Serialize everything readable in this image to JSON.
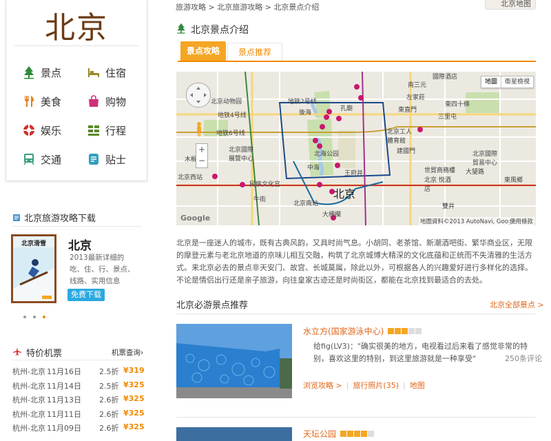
{
  "sidebar": {
    "city": "北京",
    "categories": [
      {
        "label": "景点",
        "icon": "tree-icon",
        "color": "#2e8b3a"
      },
      {
        "label": "住宿",
        "icon": "bed-icon",
        "color": "#9a8a2a"
      },
      {
        "label": "美食",
        "icon": "fork-knife-icon",
        "color": "#e08020"
      },
      {
        "label": "购物",
        "icon": "shopping-bag-icon",
        "color": "#d0307a"
      },
      {
        "label": "娱乐",
        "icon": "lifebuoy-icon",
        "color": "#d03030"
      },
      {
        "label": "行程",
        "icon": "grid-icon",
        "color": "#5a8a2a"
      },
      {
        "label": "交通",
        "icon": "train-icon",
        "color": "#3aa07a"
      },
      {
        "label": "贴士",
        "icon": "note-icon",
        "color": "#30a0c0"
      }
    ]
  },
  "download": {
    "title": "北京旅游攻略下载",
    "book_cover_title": "北京滑雪",
    "book_name": "北京",
    "desc": "2013最新详细的吃、住、行、景点、线路、实用信息",
    "button": "免费下载"
  },
  "flights": {
    "title": "特价机票",
    "query": "机票查询›",
    "rows": [
      {
        "route": "杭州-北京",
        "date": "11月16日",
        "discount": "2.5折",
        "price": "¥319"
      },
      {
        "route": "杭州-北京",
        "date": "11月14日",
        "discount": "2.5折",
        "price": "¥325"
      },
      {
        "route": "杭州-北京",
        "date": "11月13日",
        "discount": "2.6折",
        "price": "¥325"
      },
      {
        "route": "杭州-北京",
        "date": "11月11日",
        "discount": "2.6折",
        "price": "¥325"
      },
      {
        "route": "杭州-北京",
        "date": "11月09日",
        "discount": "2.6折",
        "price": "¥325"
      }
    ]
  },
  "breadcrumb": [
    "旅游攻略",
    "北京旅游攻略",
    "北京景点介绍"
  ],
  "map_button": "北京地图",
  "section_title": "北京景点介绍",
  "tabs": [
    "景点攻略",
    "景点推荐"
  ],
  "map": {
    "type_buttons": [
      "地圖",
      "衛星檢視"
    ],
    "copyright": "地圖資料©2013 AutoNavi, Google",
    "terms": "使用條款",
    "google": "Google",
    "center_label": "北京",
    "labels": [
      "北京动物园",
      "地铁4号线",
      "地铁2号线",
      "地铁6号线",
      "北京國際展覽中心",
      "北京西站",
      "民族文化宫",
      "中海",
      "北海公园",
      "王府井",
      "北京工人體育館",
      "東直門",
      "左家莊",
      "三里屯",
      "世貿商務樓",
      "大望路",
      "北京國際貿易中心",
      "雙井",
      "後海",
      "孔廟",
      "南三元",
      "建國門",
      "東四十條",
      "大柵欄",
      "北京南站",
      "牛街",
      "木樨地",
      "國際酒店",
      "東風鄉",
      "北京 悅酒店"
    ]
  },
  "intro": "北京是一座迷人的城市，既有古典风韵，又具时尚气息。小胡同、老茶馆、新潮酒吧街、繁华商业区，无限的摩登元素与老北京地道的京味儿相互交融，构筑了北京城博大精深的文化底蕴和正统而不失清雅的生活方式。来北京必去的景点非天安门、故宫、长城莫属，除此以外，可根据各人的兴趣爱好进行多样化的选择。不论是情侣出行还是亲子旅游，向往皇家古迹还是时尚街区，都能在北京找到最适合的去处。",
  "recommend": {
    "title": "北京必游景点推荐",
    "all_link": "北京全部景点 >",
    "items": [
      {
        "name": "水立方(国家游泳中心)",
        "stars": 3,
        "user": "给fig(LV3)",
        "quote": "：\"确实很美的地方，电视看过后来看了感觉非常的特别，喜欢这里的特别，到这里旅游就是一种享受\"",
        "reviews": "250条评论",
        "links": [
          "浏览攻略 >",
          "旅行照片(35)",
          "地图"
        ]
      },
      {
        "name": "天坛公园",
        "stars": 4
      }
    ]
  },
  "colors": {
    "accent": "#f08a00",
    "link": "#e0661a",
    "title_brown": "#6b3a14"
  }
}
